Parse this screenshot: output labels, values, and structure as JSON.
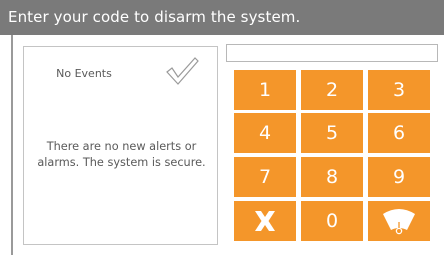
{
  "header": {
    "title": "Enter your code to disarm the system."
  },
  "events_panel": {
    "title": "No Events",
    "message": "There are no new alerts or alarms. The system is secure.",
    "icon": "check-icon"
  },
  "code_input": {
    "value": "",
    "placeholder": ""
  },
  "keypad": {
    "keys": [
      {
        "label": "1",
        "name": "key-1"
      },
      {
        "label": "2",
        "name": "key-2"
      },
      {
        "label": "3",
        "name": "key-3"
      },
      {
        "label": "4",
        "name": "key-4"
      },
      {
        "label": "5",
        "name": "key-5"
      },
      {
        "label": "6",
        "name": "key-6"
      },
      {
        "label": "7",
        "name": "key-7"
      },
      {
        "label": "8",
        "name": "key-8"
      },
      {
        "label": "9",
        "name": "key-9"
      },
      {
        "label": "",
        "name": "clear-key",
        "icon": "x-icon"
      },
      {
        "label": "0",
        "name": "key-0"
      },
      {
        "label": "",
        "name": "panic-key",
        "icon": "siren-icon"
      }
    ]
  },
  "colors": {
    "header_bg": "#7a7a7a",
    "key_bg": "#f4962a",
    "text": "#5a5a5a"
  }
}
